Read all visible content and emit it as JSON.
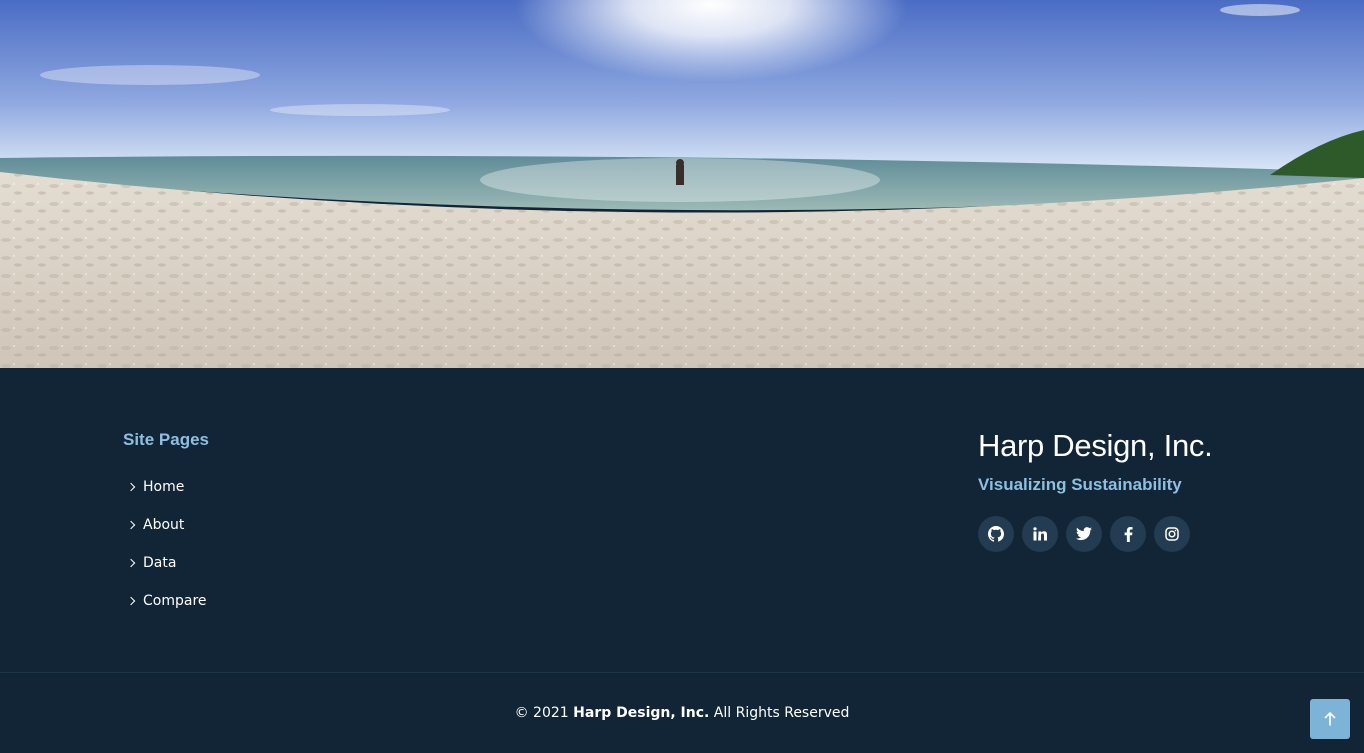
{
  "hero": {
    "image_description_icon": "beach-panorama-image"
  },
  "footer": {
    "site_pages_title": "Site Pages",
    "links": [
      {
        "label": "Home"
      },
      {
        "label": "About"
      },
      {
        "label": "Data"
      },
      {
        "label": "Compare"
      }
    ],
    "brand_name": "Harp Design, Inc.",
    "tagline": "Visualizing Sustainability",
    "socials": [
      {
        "icon": "github-icon"
      },
      {
        "icon": "linkedin-icon"
      },
      {
        "icon": "twitter-icon"
      },
      {
        "icon": "facebook-icon"
      },
      {
        "icon": "instagram-icon"
      }
    ]
  },
  "copyright": {
    "prefix": "© 2021",
    "company": "Harp Design, Inc.",
    "suffix": "All Rights Reserved"
  },
  "back_to_top_icon": "arrow-up-icon",
  "colors": {
    "footer_bg": "#112536",
    "accent": "#8fbfe0",
    "social_bg": "#243c52",
    "to_top_bg": "#7eb3d8"
  }
}
